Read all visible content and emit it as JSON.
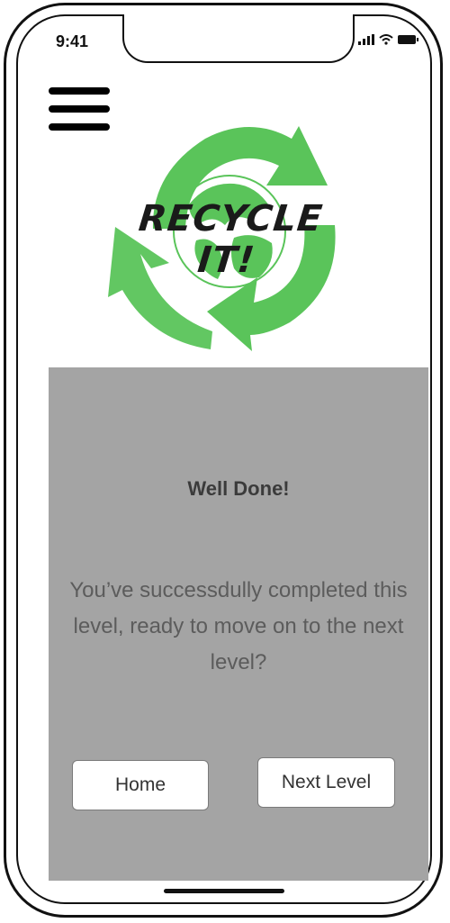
{
  "status_bar": {
    "time": "9:41"
  },
  "header": {
    "menu_icon": "hamburger-menu-icon"
  },
  "logo": {
    "title": "RECYCLE IT!",
    "arrow_color": "#5ac45a",
    "globe_color": "#5ac45a"
  },
  "dialog": {
    "heading": "Well Done!",
    "message": "You’ve successdully completed this level, ready to move on to the next level?",
    "buttons": {
      "home_label": "Home",
      "next_label": "Next Level"
    }
  },
  "colors": {
    "panel_bg": "#a4a4a4",
    "button_bg": "#ffffff",
    "accent_green": "#5ac45a"
  }
}
